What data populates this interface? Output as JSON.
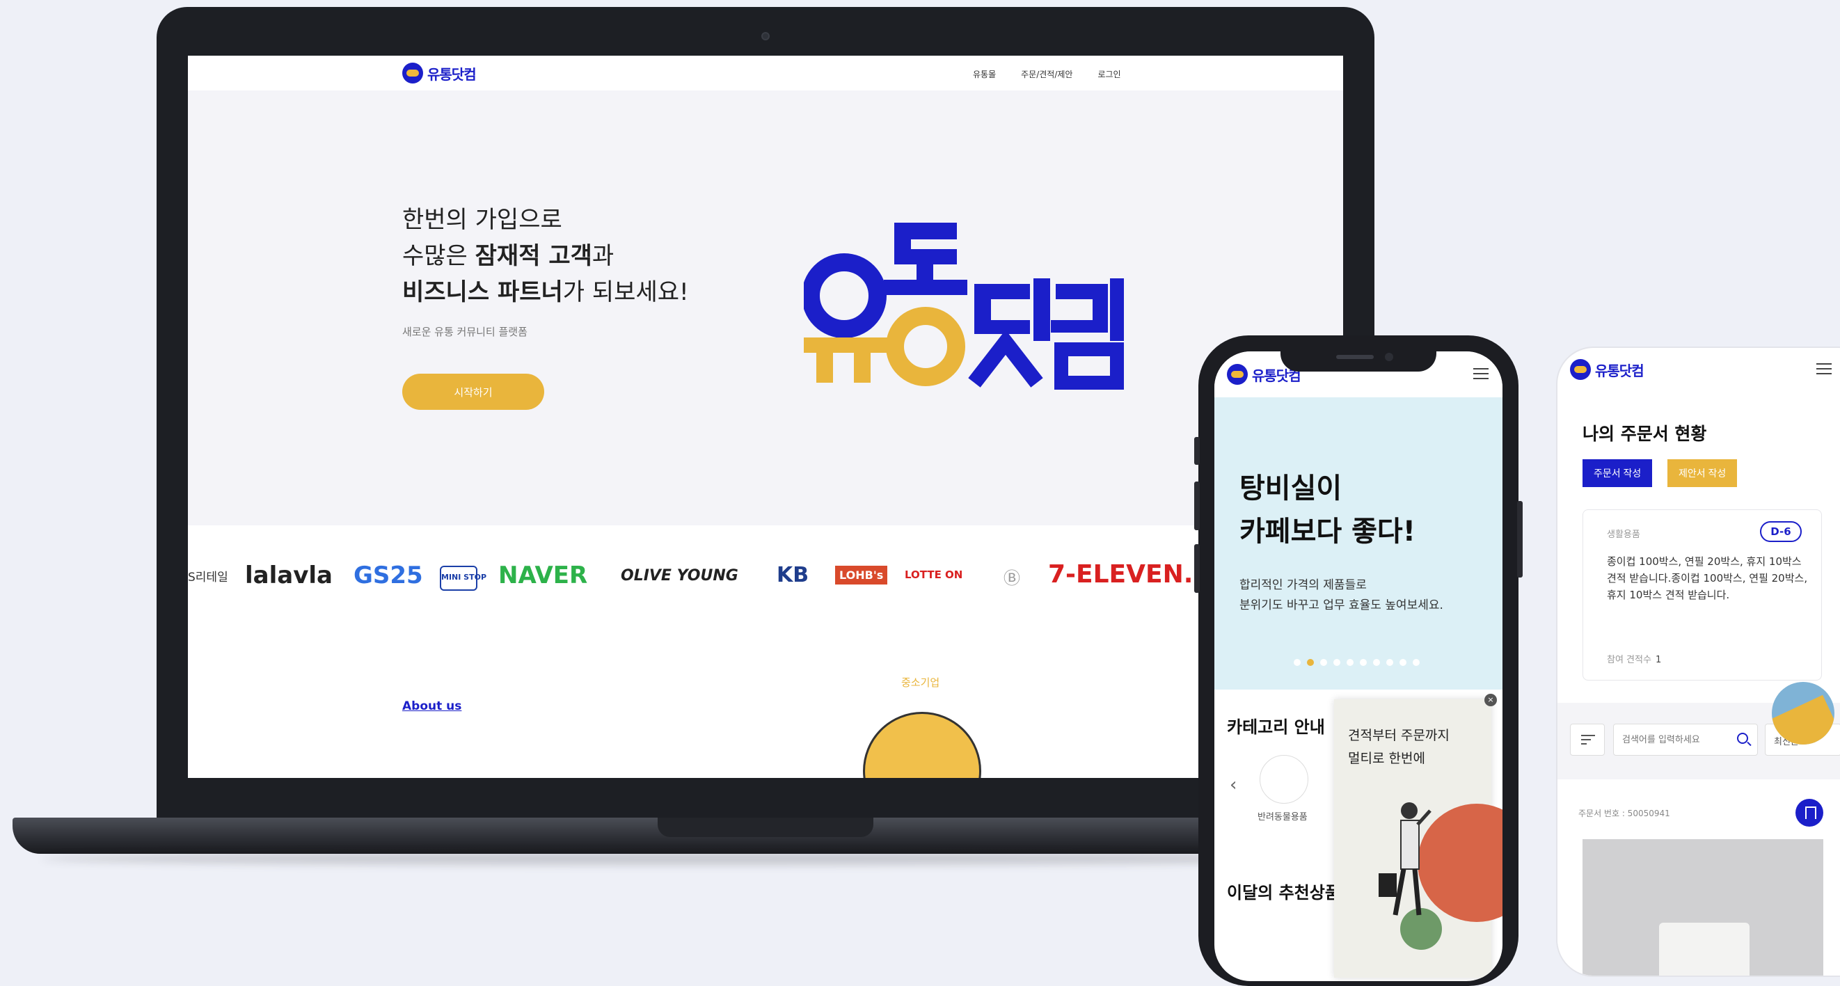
{
  "desktop": {
    "logo_text": "유통닷컴",
    "nav": [
      "유통몰",
      "주문/견적/제안",
      "로그인"
    ],
    "hero": {
      "line1": "한번의 가입으로",
      "line2_pre": "수많은 ",
      "line2_bold": "잠재적 고객",
      "line2_post": "과",
      "line3_bold": "비즈니스 파트너",
      "line3_post": "가 되보세요!",
      "subtitle": "새로운 유통 커뮤니티 플랫폼",
      "cta": "시작하기"
    },
    "brands": [
      "S리테일",
      "lalavla",
      "GS25",
      "MINI STOP",
      "NAVER",
      "OLIVE YOUNG",
      "KB",
      "LOHB's",
      "LOTTE ON",
      "Ⓑ",
      "7-ELEVEN."
    ],
    "about": {
      "sme_label": "중소기업",
      "link": "About us"
    }
  },
  "phone1": {
    "logo_text": "유통닷컴",
    "banner": {
      "title_line1": "탕비실이",
      "title_line2": "카페보다 좋다!",
      "desc_line1": "합리적인 가격의 제품들로",
      "desc_line2": "분위기도 바꾸고 업무 효율도 높여보세요."
    },
    "category_title": "카테고리 안내",
    "category_items": [
      "반려동물용품"
    ],
    "recommend_title": "이달의 추천상품",
    "popup": {
      "line1": "견적부터 주문까지",
      "line2": "멀티로 한번에",
      "close": "×"
    }
  },
  "phone2": {
    "logo_text": "유통닷컴",
    "title": "나의 주문서 현황",
    "btn_order": "주문서 작성",
    "btn_proposal": "제안서 작성",
    "card": {
      "category": "생활용품",
      "dday": "D-6",
      "text": "종이컵 100박스, 연필 20박스, 휴지 10박스 견적 받습니다.종이컵 100박스, 연필 20박스, 휴지 10박스 견적 받습니다.",
      "bids_label": "참여 견적수",
      "bids_count": "1"
    },
    "search_placeholder": "검색어를 입력하세요",
    "sort_label": "최신순",
    "order_no": "주문서 번호 : 50050941"
  },
  "colors": {
    "brand_blue": "#1b1fc9",
    "brand_yellow": "#e9b53c",
    "banner_bg": "#dcf0f6"
  }
}
